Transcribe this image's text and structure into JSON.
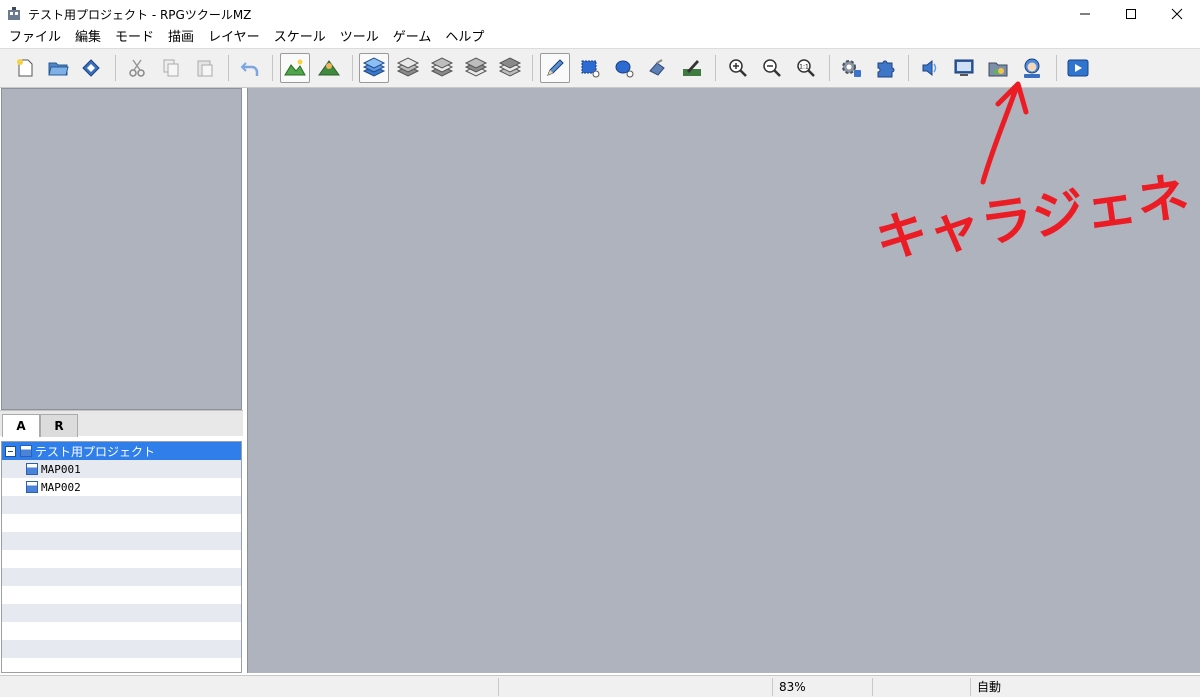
{
  "window": {
    "title": "テスト用プロジェクト - RPGツクールMZ",
    "minimize": "─",
    "maximize": "☐",
    "close": "✕"
  },
  "menu": [
    "ファイル",
    "編集",
    "モード",
    "描画",
    "レイヤー",
    "スケール",
    "ツール",
    "ゲーム",
    "ヘルプ"
  ],
  "tabs": {
    "a": "A",
    "r": "R"
  },
  "tree": {
    "project": "テスト用プロジェクト",
    "maps": [
      "MAP001",
      "MAP002"
    ]
  },
  "status": {
    "zoom": "83%",
    "mode": "自動"
  },
  "annotation": {
    "label": "キャラジェネ"
  },
  "colors": {
    "annotation": "#ec1c24",
    "map_bg": "#aeb3bd",
    "selection": "#2f7ee9"
  }
}
